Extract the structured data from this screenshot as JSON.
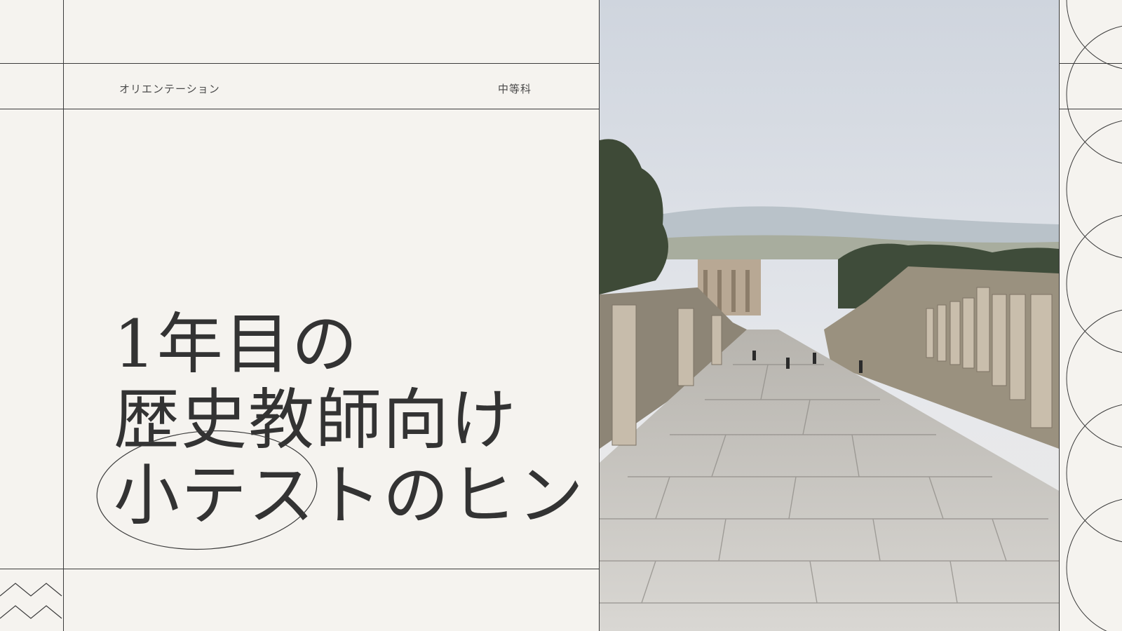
{
  "header": {
    "left_label": "オリエンテーション",
    "right_label": "中等科"
  },
  "title": {
    "line1": "1年目の",
    "line2": "歴史教師向け",
    "line3": "小テストのヒント"
  },
  "photo": {
    "subject": "ancient-ruins-colonnaded-street"
  },
  "colors": {
    "background": "#f5f3ef",
    "line": "#3b3b3b",
    "text": "#333333",
    "sky": "#dfe3ea"
  }
}
